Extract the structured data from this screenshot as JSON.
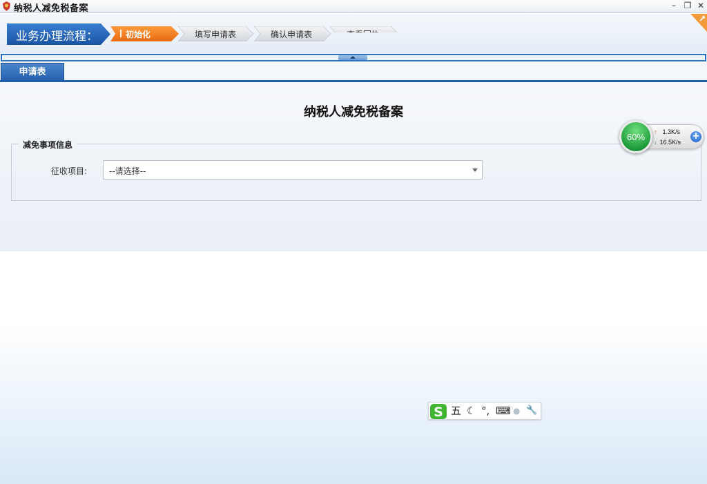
{
  "window": {
    "title": "纳税人减免税备案",
    "minimize_label": "–",
    "maximize_label": "❐",
    "close_label": "✕"
  },
  "workflow": {
    "title": "业务办理流程：",
    "steps": [
      {
        "label": "初始化",
        "state": "active"
      },
      {
        "label": "填写申请表",
        "state": "pending"
      },
      {
        "label": "确认申请表",
        "state": "pending"
      },
      {
        "label": "查看回执",
        "state": "pending"
      }
    ]
  },
  "tabs": [
    {
      "label": "申请表",
      "active": true
    }
  ],
  "form": {
    "heading": "纳税人减免税备案",
    "section_title": "减免事项信息",
    "fields": [
      {
        "label": "征收项目:",
        "value": "--请选择--"
      }
    ]
  },
  "net_widget": {
    "percent": "60%",
    "upload": "1.3K/s",
    "download": "16.5K/s",
    "upload_arrow": "↑",
    "download_arrow": "↓",
    "plus_label": "+"
  },
  "ime_toolbar": {
    "logo": "S",
    "mode": "五",
    "moon": "☾",
    "punct": "°,",
    "keyboard": "⌨",
    "user": "●",
    "tools": "🔧"
  },
  "colors": {
    "accent_blue": "#1f5fae",
    "active_step_orange": "#f07a1f",
    "net_green": "#1f9c3c"
  }
}
